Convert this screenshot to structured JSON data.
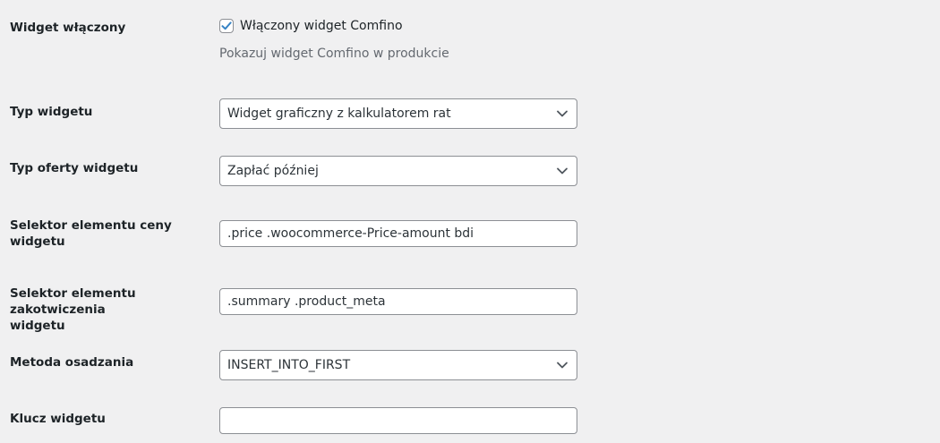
{
  "settings": {
    "widget_enabled": {
      "label": "Widget włączony",
      "checkbox_label": "Włączony widget Comfino",
      "checked": true,
      "description": "Pokazuj widget Comfino w produkcie"
    },
    "widget_type": {
      "label": "Typ widgetu",
      "value": "Widget graficzny z kalkulatorem rat"
    },
    "offer_type": {
      "label": "Typ oferty widgetu",
      "value": "Zapłać później"
    },
    "price_selector": {
      "label": "Selektor elementu ceny widgetu",
      "value": ".price .woocommerce-Price-amount bdi"
    },
    "anchor_selector": {
      "label": "Selektor elementu zakotwiczenia widgetu",
      "value": ".summary .product_meta"
    },
    "embed_method": {
      "label": "Metoda osadzania",
      "value": "INSERT_INTO_FIRST"
    },
    "widget_key": {
      "label": "Klucz widgetu",
      "value": ""
    }
  },
  "colors": {
    "background": "#f0f0f1",
    "checkbox_accent": "#3582c4",
    "input_border": "#8c8f94"
  },
  "icons": {
    "checkbox_check": "check-icon",
    "select_arrow": "chevron-down-icon"
  }
}
